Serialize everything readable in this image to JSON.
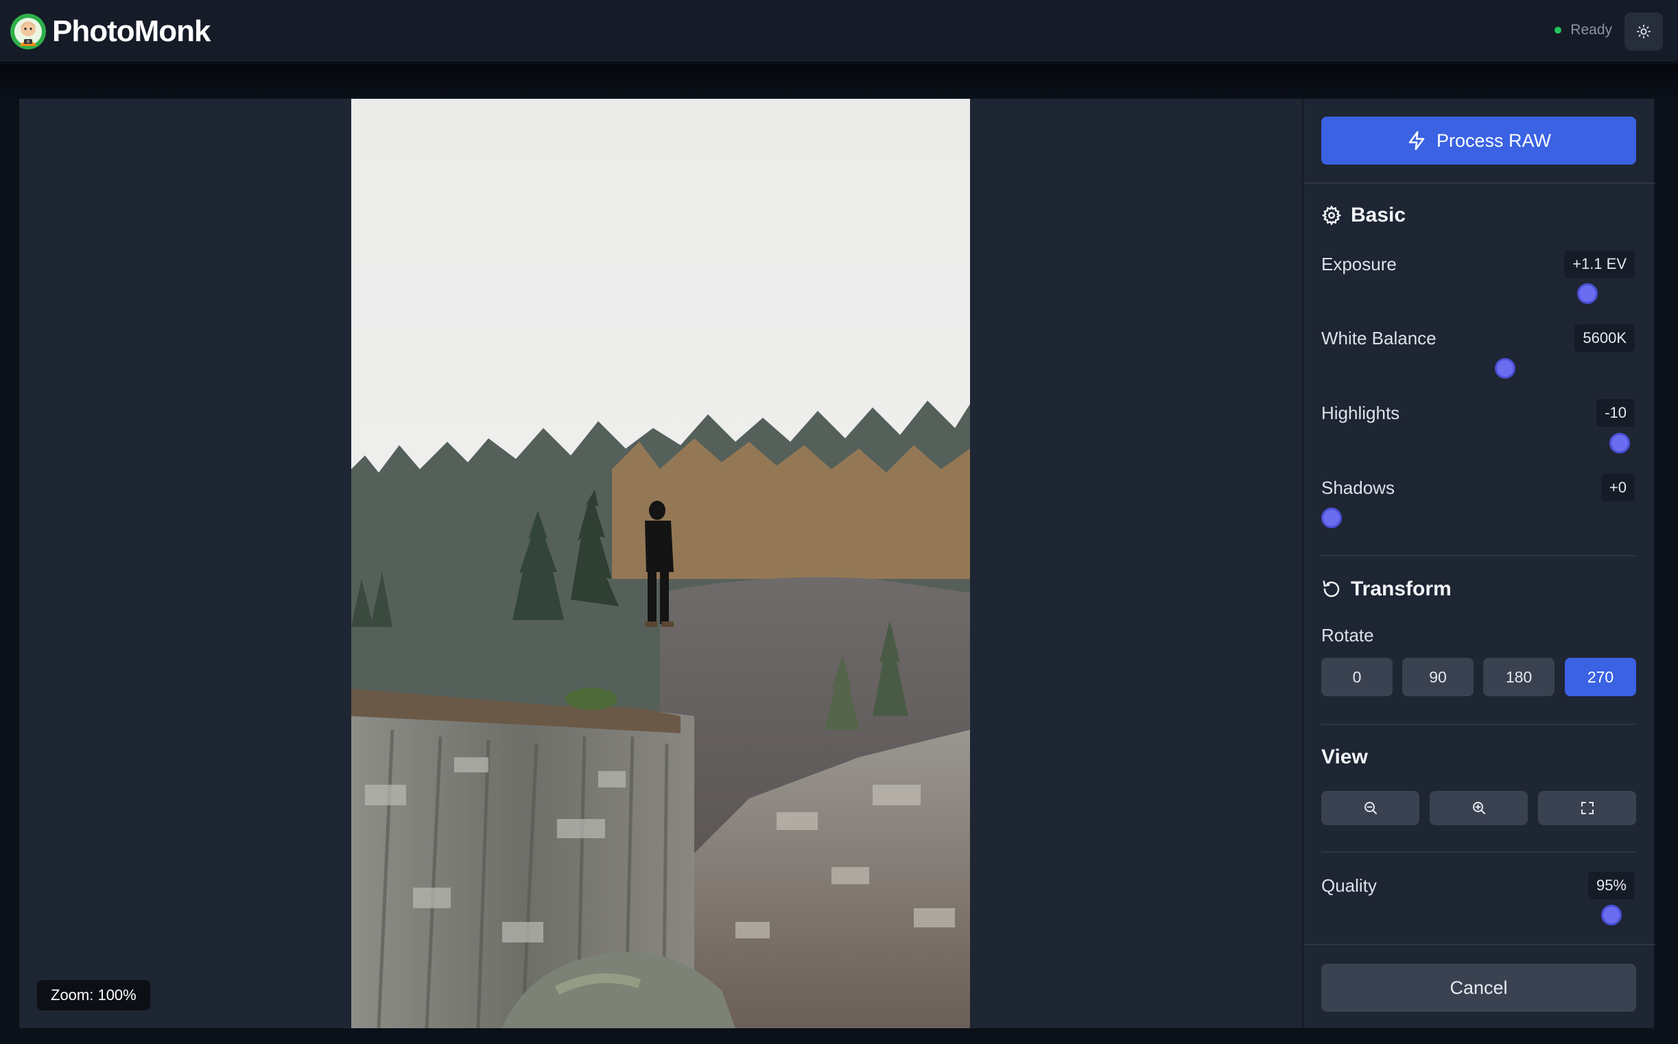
{
  "app": {
    "name": "PhotoMonk",
    "status": "Ready",
    "accent_color": "#3a62e3",
    "status_color": "#22c55e"
  },
  "canvas": {
    "zoom_label": "Zoom: 100%",
    "zoom_percent": 100
  },
  "panel": {
    "process_label": "Process RAW",
    "basic": {
      "title": "Basic",
      "controls": [
        {
          "label": "Exposure",
          "value": "+1.1 EV",
          "position": 0.87
        },
        {
          "label": "White Balance",
          "value": "5600K",
          "position": 0.59
        },
        {
          "label": "Highlights",
          "value": "-10",
          "position": 0.98
        },
        {
          "label": "Shadows",
          "value": "+0",
          "position": 0.0
        }
      ]
    },
    "transform": {
      "title": "Transform",
      "rotate_label": "Rotate",
      "rotate_options": [
        "0",
        "90",
        "180",
        "270"
      ],
      "rotate_selected": "270"
    },
    "view": {
      "title": "View",
      "buttons": [
        "zoom-out-icon",
        "zoom-in-icon",
        "fullscreen-icon"
      ]
    },
    "quality": {
      "label": "Quality",
      "value": "95%",
      "position": 0.95
    },
    "cancel_label": "Cancel"
  }
}
